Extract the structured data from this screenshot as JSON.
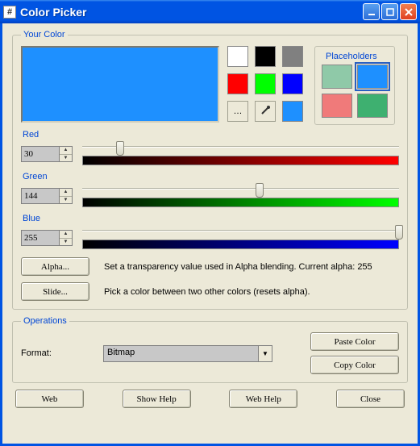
{
  "window": {
    "title": "Color Picker"
  },
  "your_color": {
    "legend": "Your Color",
    "preview_color": "#1e90ff",
    "swatches_row1": [
      "#ffffff",
      "#000000",
      "#808080"
    ],
    "swatches_row2": [
      "#ff0000",
      "#00ff00",
      "#0000ff"
    ],
    "swatches_row3_current": "#1e90ff",
    "placeholders": {
      "legend": "Placeholders",
      "colors": [
        "#8fc9a8",
        "#1e90ff",
        "#f07a7a",
        "#3eb070"
      ],
      "selected_index": 1
    }
  },
  "channels": {
    "red": {
      "label": "Red",
      "value": "30",
      "pos_pct": 12,
      "grad_color": "#ff0000"
    },
    "green": {
      "label": "Green",
      "value": "144",
      "pos_pct": 56,
      "grad_color": "#00ff00"
    },
    "blue": {
      "label": "Blue",
      "value": "255",
      "pos_pct": 100,
      "grad_color": "#0000ff"
    }
  },
  "alpha_btn": "Alpha...",
  "alpha_desc": "Set a transparency value used in Alpha blending.  Current alpha: 255",
  "slide_btn": "Slide...",
  "slide_desc": "Pick a color between two other colors (resets alpha).",
  "operations": {
    "legend": "Operations",
    "format_label": "Format:",
    "format_value": "Bitmap",
    "paste": "Paste Color",
    "copy": "Copy Color"
  },
  "bottom": {
    "web": "Web",
    "show_help": "Show Help",
    "web_help": "Web Help",
    "close": "Close"
  }
}
